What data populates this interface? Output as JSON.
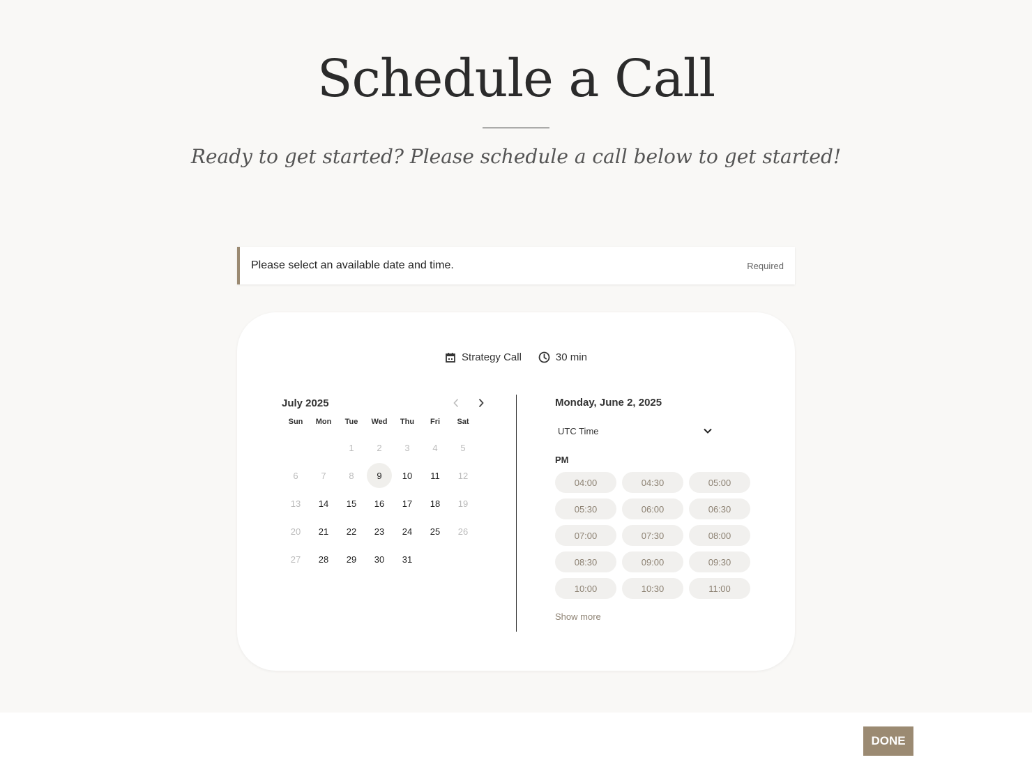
{
  "header": {
    "title": "Schedule a Call",
    "subtitle": "Ready to get started? Please schedule a call below to get started!"
  },
  "notice": {
    "text": "Please select an available date and time.",
    "required_label": "Required"
  },
  "event": {
    "name": "Strategy Call",
    "duration": "30 min",
    "name_icon": "calendar-icon",
    "duration_icon": "clock-icon"
  },
  "calendar": {
    "month_label": "July 2025",
    "weekdays": [
      "Sun",
      "Mon",
      "Tue",
      "Wed",
      "Thu",
      "Fri",
      "Sat"
    ],
    "leading_blanks": 2,
    "days": [
      {
        "n": "1",
        "state": "disabled"
      },
      {
        "n": "2",
        "state": "disabled"
      },
      {
        "n": "3",
        "state": "disabled"
      },
      {
        "n": "4",
        "state": "disabled"
      },
      {
        "n": "5",
        "state": "disabled"
      },
      {
        "n": "6",
        "state": "disabled"
      },
      {
        "n": "7",
        "state": "disabled"
      },
      {
        "n": "8",
        "state": "disabled"
      },
      {
        "n": "9",
        "state": "selected"
      },
      {
        "n": "10",
        "state": "available"
      },
      {
        "n": "11",
        "state": "available"
      },
      {
        "n": "12",
        "state": "disabled"
      },
      {
        "n": "13",
        "state": "disabled"
      },
      {
        "n": "14",
        "state": "available"
      },
      {
        "n": "15",
        "state": "available"
      },
      {
        "n": "16",
        "state": "available"
      },
      {
        "n": "17",
        "state": "available"
      },
      {
        "n": "18",
        "state": "available"
      },
      {
        "n": "19",
        "state": "disabled"
      },
      {
        "n": "20",
        "state": "disabled"
      },
      {
        "n": "21",
        "state": "available"
      },
      {
        "n": "22",
        "state": "available"
      },
      {
        "n": "23",
        "state": "available"
      },
      {
        "n": "24",
        "state": "available"
      },
      {
        "n": "25",
        "state": "available"
      },
      {
        "n": "26",
        "state": "disabled"
      },
      {
        "n": "27",
        "state": "disabled"
      },
      {
        "n": "28",
        "state": "available"
      },
      {
        "n": "29",
        "state": "available"
      },
      {
        "n": "30",
        "state": "available"
      },
      {
        "n": "31",
        "state": "available"
      }
    ]
  },
  "times": {
    "date_label": "Monday, June 2, 2025",
    "timezone": "UTC Time",
    "period": "PM",
    "slots": [
      "04:00",
      "04:30",
      "05:00",
      "05:30",
      "06:00",
      "06:30",
      "07:00",
      "07:30",
      "08:00",
      "08:30",
      "09:00",
      "09:30",
      "10:00",
      "10:30",
      "11:00"
    ],
    "show_more": "Show more"
  },
  "footer": {
    "done_label": "DONE"
  },
  "colors": {
    "accent": "#9b8a72",
    "slot_text": "#8d8273",
    "slot_bg": "#f1f0ee",
    "background": "#f9f8f6"
  }
}
